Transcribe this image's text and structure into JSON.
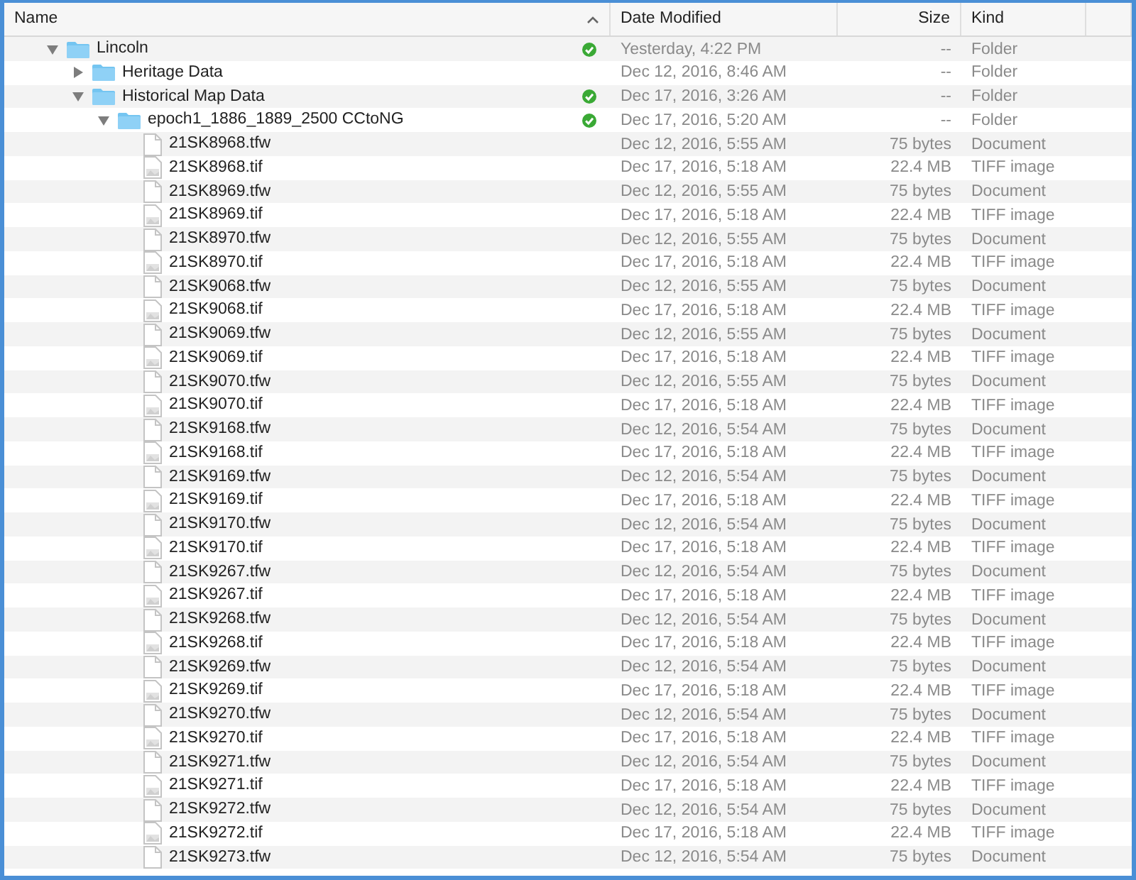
{
  "columns": [
    {
      "label": "Name",
      "sorted": true
    },
    {
      "label": "Date Modified",
      "sorted": false
    },
    {
      "label": "Size",
      "sorted": false
    },
    {
      "label": "Kind",
      "sorted": false
    }
  ],
  "items": [
    {
      "name": "Lincoln",
      "kind": "folder",
      "expanded": true,
      "synced": true,
      "date": "Yesterday, 4:22 PM",
      "size": "--",
      "kind_label": "Folder",
      "children": [
        {
          "name": "Heritage Data",
          "kind": "folder",
          "expanded": false,
          "synced": false,
          "date": "Dec 12, 2016, 8:46 AM",
          "size": "--",
          "kind_label": "Folder"
        },
        {
          "name": "Historical Map Data",
          "kind": "folder",
          "expanded": true,
          "synced": true,
          "date": "Dec 17, 2016, 3:26 AM",
          "size": "--",
          "kind_label": "Folder",
          "children": [
            {
              "name": "epoch1_1886_1889_2500 CCtoNG",
              "kind": "folder",
              "expanded": true,
              "synced": true,
              "date": "Dec 17, 2016, 5:20 AM",
              "size": "--",
              "kind_label": "Folder",
              "children": [
                {
                  "name": "21SK8968.tfw",
                  "kind": "document",
                  "date": "Dec 12, 2016, 5:55 AM",
                  "size": "75 bytes",
                  "kind_label": "Document"
                },
                {
                  "name": "21SK8968.tif",
                  "kind": "image",
                  "date": "Dec 17, 2016, 5:18 AM",
                  "size": "22.4 MB",
                  "kind_label": "TIFF image"
                },
                {
                  "name": "21SK8969.tfw",
                  "kind": "document",
                  "date": "Dec 12, 2016, 5:55 AM",
                  "size": "75 bytes",
                  "kind_label": "Document"
                },
                {
                  "name": "21SK8969.tif",
                  "kind": "image",
                  "date": "Dec 17, 2016, 5:18 AM",
                  "size": "22.4 MB",
                  "kind_label": "TIFF image"
                },
                {
                  "name": "21SK8970.tfw",
                  "kind": "document",
                  "date": "Dec 12, 2016, 5:55 AM",
                  "size": "75 bytes",
                  "kind_label": "Document"
                },
                {
                  "name": "21SK8970.tif",
                  "kind": "image",
                  "date": "Dec 17, 2016, 5:18 AM",
                  "size": "22.4 MB",
                  "kind_label": "TIFF image"
                },
                {
                  "name": "21SK9068.tfw",
                  "kind": "document",
                  "date": "Dec 12, 2016, 5:55 AM",
                  "size": "75 bytes",
                  "kind_label": "Document"
                },
                {
                  "name": "21SK9068.tif",
                  "kind": "image",
                  "date": "Dec 17, 2016, 5:18 AM",
                  "size": "22.4 MB",
                  "kind_label": "TIFF image"
                },
                {
                  "name": "21SK9069.tfw",
                  "kind": "document",
                  "date": "Dec 12, 2016, 5:55 AM",
                  "size": "75 bytes",
                  "kind_label": "Document"
                },
                {
                  "name": "21SK9069.tif",
                  "kind": "image",
                  "date": "Dec 17, 2016, 5:18 AM",
                  "size": "22.4 MB",
                  "kind_label": "TIFF image"
                },
                {
                  "name": "21SK9070.tfw",
                  "kind": "document",
                  "date": "Dec 12, 2016, 5:55 AM",
                  "size": "75 bytes",
                  "kind_label": "Document"
                },
                {
                  "name": "21SK9070.tif",
                  "kind": "image",
                  "date": "Dec 17, 2016, 5:18 AM",
                  "size": "22.4 MB",
                  "kind_label": "TIFF image"
                },
                {
                  "name": "21SK9168.tfw",
                  "kind": "document",
                  "date": "Dec 12, 2016, 5:54 AM",
                  "size": "75 bytes",
                  "kind_label": "Document"
                },
                {
                  "name": "21SK9168.tif",
                  "kind": "image",
                  "date": "Dec 17, 2016, 5:18 AM",
                  "size": "22.4 MB",
                  "kind_label": "TIFF image"
                },
                {
                  "name": "21SK9169.tfw",
                  "kind": "document",
                  "date": "Dec 12, 2016, 5:54 AM",
                  "size": "75 bytes",
                  "kind_label": "Document"
                },
                {
                  "name": "21SK9169.tif",
                  "kind": "image",
                  "date": "Dec 17, 2016, 5:18 AM",
                  "size": "22.4 MB",
                  "kind_label": "TIFF image"
                },
                {
                  "name": "21SK9170.tfw",
                  "kind": "document",
                  "date": "Dec 12, 2016, 5:54 AM",
                  "size": "75 bytes",
                  "kind_label": "Document"
                },
                {
                  "name": "21SK9170.tif",
                  "kind": "image",
                  "date": "Dec 17, 2016, 5:18 AM",
                  "size": "22.4 MB",
                  "kind_label": "TIFF image"
                },
                {
                  "name": "21SK9267.tfw",
                  "kind": "document",
                  "date": "Dec 12, 2016, 5:54 AM",
                  "size": "75 bytes",
                  "kind_label": "Document"
                },
                {
                  "name": "21SK9267.tif",
                  "kind": "image",
                  "date": "Dec 17, 2016, 5:18 AM",
                  "size": "22.4 MB",
                  "kind_label": "TIFF image"
                },
                {
                  "name": "21SK9268.tfw",
                  "kind": "document",
                  "date": "Dec 12, 2016, 5:54 AM",
                  "size": "75 bytes",
                  "kind_label": "Document"
                },
                {
                  "name": "21SK9268.tif",
                  "kind": "image",
                  "date": "Dec 17, 2016, 5:18 AM",
                  "size": "22.4 MB",
                  "kind_label": "TIFF image"
                },
                {
                  "name": "21SK9269.tfw",
                  "kind": "document",
                  "date": "Dec 12, 2016, 5:54 AM",
                  "size": "75 bytes",
                  "kind_label": "Document"
                },
                {
                  "name": "21SK9269.tif",
                  "kind": "image",
                  "date": "Dec 17, 2016, 5:18 AM",
                  "size": "22.4 MB",
                  "kind_label": "TIFF image"
                },
                {
                  "name": "21SK9270.tfw",
                  "kind": "document",
                  "date": "Dec 12, 2016, 5:54 AM",
                  "size": "75 bytes",
                  "kind_label": "Document"
                },
                {
                  "name": "21SK9270.tif",
                  "kind": "image",
                  "date": "Dec 17, 2016, 5:18 AM",
                  "size": "22.4 MB",
                  "kind_label": "TIFF image"
                },
                {
                  "name": "21SK9271.tfw",
                  "kind": "document",
                  "date": "Dec 12, 2016, 5:54 AM",
                  "size": "75 bytes",
                  "kind_label": "Document"
                },
                {
                  "name": "21SK9271.tif",
                  "kind": "image",
                  "date": "Dec 17, 2016, 5:18 AM",
                  "size": "22.4 MB",
                  "kind_label": "TIFF image"
                },
                {
                  "name": "21SK9272.tfw",
                  "kind": "document",
                  "date": "Dec 12, 2016, 5:54 AM",
                  "size": "75 bytes",
                  "kind_label": "Document"
                },
                {
                  "name": "21SK9272.tif",
                  "kind": "image",
                  "date": "Dec 17, 2016, 5:18 AM",
                  "size": "22.4 MB",
                  "kind_label": "TIFF image"
                },
                {
                  "name": "21SK9273.tfw",
                  "kind": "document",
                  "date": "Dec 12, 2016, 5:54 AM",
                  "size": "75 bytes",
                  "kind_label": "Document"
                }
              ]
            }
          ]
        }
      ]
    }
  ]
}
